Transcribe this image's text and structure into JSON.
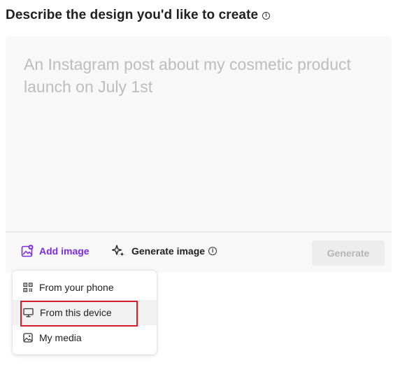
{
  "heading": {
    "title": "Describe the design you'd like to create",
    "info_icon": "info-icon"
  },
  "prompt": {
    "placeholder": "An Instagram post about my cosmetic product launch on July 1st"
  },
  "toolbar": {
    "add_image_label": "Add image",
    "generate_image_label": "Generate image",
    "generate_button_label": "Generate"
  },
  "menu": {
    "items": [
      {
        "label": "From your phone",
        "icon": "qr-code-icon"
      },
      {
        "label": "From this device",
        "icon": "monitor-icon"
      },
      {
        "label": "My media",
        "icon": "image-icon"
      }
    ]
  },
  "colors": {
    "accent": "#7d2ae8",
    "highlight": "#d3202a",
    "prompt_bg": "#f8f8f8",
    "placeholder_text": "#bdbdbd"
  }
}
